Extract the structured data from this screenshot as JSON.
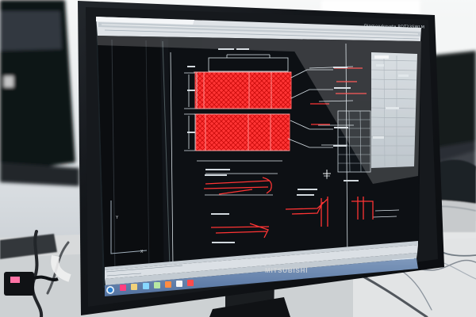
{
  "scene": {
    "monitor_brand": "MITSUBISHI",
    "monitor_model": "Diamondcrysta RDT235WLM"
  },
  "colors": {
    "cad_background": "#0d1014",
    "cad_drawing": "#ff2f2f",
    "cad_lines": "#b8c3cc",
    "monitor_bezel": "#111418",
    "taskbar": "#5b79a6"
  },
  "icons": [
    "start-orb-icon",
    "taskbar-app-icon",
    "cursor-crosshair-icon",
    "ucs-axis-icon"
  ]
}
